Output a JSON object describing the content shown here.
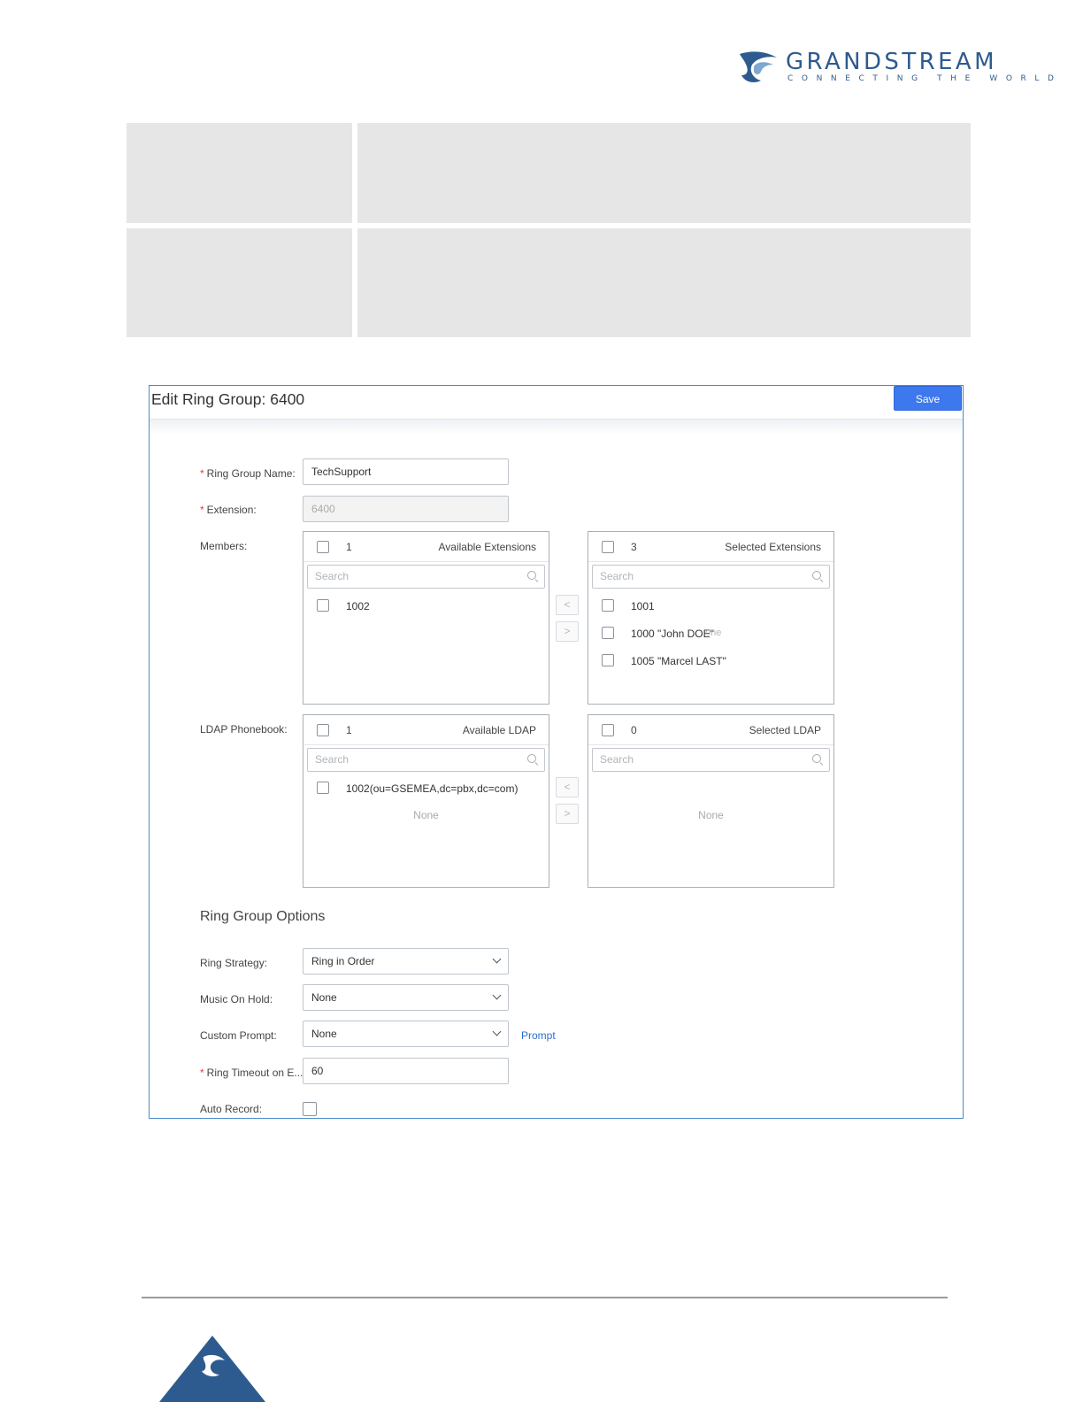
{
  "brand": {
    "name": "GRANDSTREAM",
    "tagline": "CONNECTING THE WORLD",
    "color": "#2e5b8f"
  },
  "window": {
    "title": "Edit Ring Group: 6400",
    "save_label": "Save"
  },
  "form": {
    "ring_group_name": {
      "label": "Ring Group Name",
      "value": "TechSupport"
    },
    "extension": {
      "label": "Extension",
      "value": "6400"
    },
    "members_label": "Members",
    "ldap_label": "LDAP Phonebook"
  },
  "members": {
    "available": {
      "count": "1",
      "title": "Available Extensions",
      "search_placeholder": "Search",
      "items": [
        "1002"
      ]
    },
    "selected": {
      "count": "3",
      "title": "Selected Extensions",
      "search_placeholder": "Search",
      "items": [
        "1001",
        "1000 \"John DOE\"",
        "1005 \"Marcel LAST\""
      ],
      "ghost_text": "one"
    }
  },
  "ldap": {
    "available": {
      "count": "1",
      "title": "Available LDAP",
      "search_placeholder": "Search",
      "items": [
        "1002(ou=GSEMEA,dc=pbx,dc=com)"
      ],
      "empty_text": "None"
    },
    "selected": {
      "count": "0",
      "title": "Selected LDAP",
      "search_placeholder": "Search",
      "empty_text": "None"
    }
  },
  "options": {
    "section_title": "Ring Group Options",
    "ring_strategy": {
      "label": "Ring Strategy",
      "value": "Ring in Order"
    },
    "music_on_hold": {
      "label": "Music On Hold",
      "value": "None"
    },
    "custom_prompt": {
      "label": "Custom Prompt",
      "value": "None",
      "link": "Prompt"
    },
    "ring_timeout": {
      "label": "Ring Timeout on E...",
      "value": "60"
    },
    "auto_record": {
      "label": "Auto Record",
      "checked": false
    }
  },
  "arrows": {
    "left": "<",
    "right": ">"
  },
  "colors": {
    "accent": "#3d78ee",
    "window_border": "#4a8ac8",
    "required": "#e04040",
    "link": "#2a6fc9"
  }
}
